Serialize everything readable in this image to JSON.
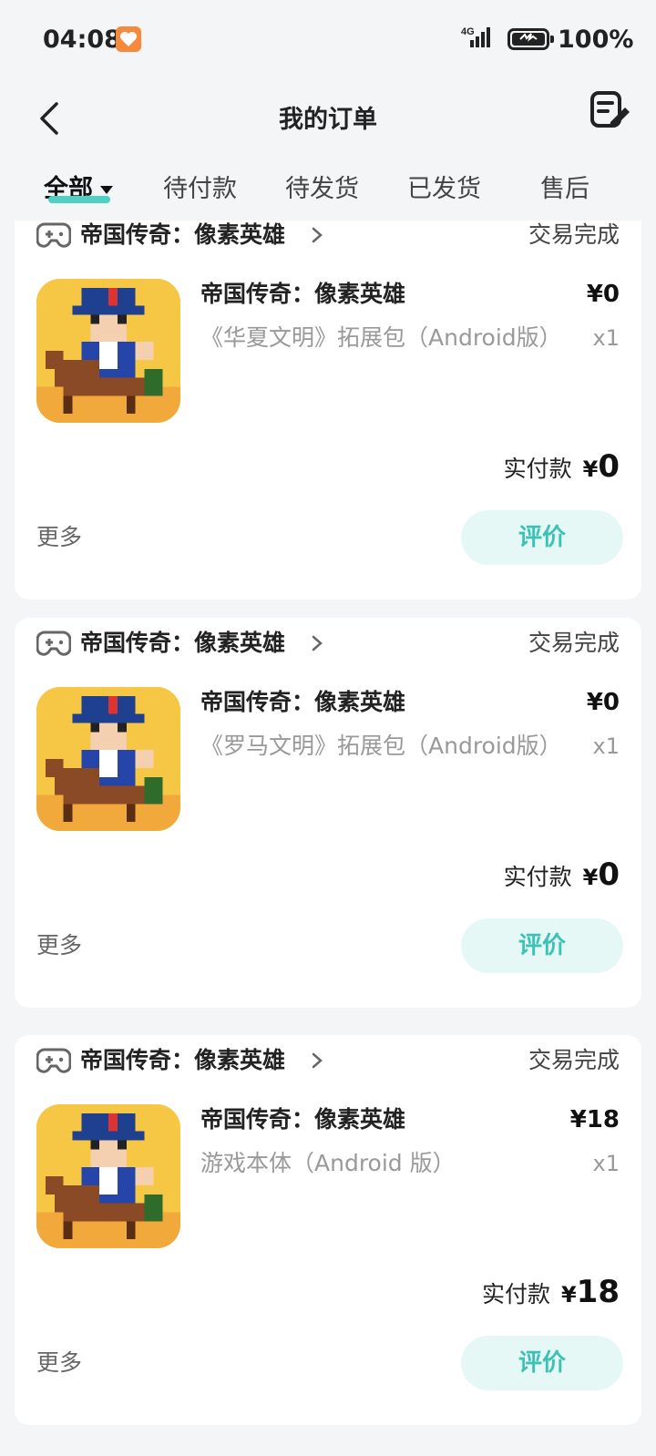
{
  "status_bar": {
    "time": "04:08",
    "network": "4G",
    "battery": "100%"
  },
  "header": {
    "title": "我的订单"
  },
  "tabs": [
    {
      "label": "全部",
      "active": true
    },
    {
      "label": "待付款",
      "active": false
    },
    {
      "label": "待发货",
      "active": false
    },
    {
      "label": "已发货",
      "active": false
    },
    {
      "label": "售后",
      "active": false
    }
  ],
  "orders": [
    {
      "store_name": "帝国传奇：像素英雄",
      "status": "交易完成",
      "product_title": "帝国传奇：像素英雄",
      "price": "¥0",
      "description": "《华夏文明》拓展包（Android版）",
      "quantity": "x1",
      "paid_label": "实付款",
      "paid_currency": "¥",
      "paid_amount": "0",
      "more_label": "更多",
      "review_label": "评价"
    },
    {
      "store_name": "帝国传奇：像素英雄",
      "status": "交易完成",
      "product_title": "帝国传奇：像素英雄",
      "price": "¥0",
      "description": "《罗马文明》拓展包（Android版）",
      "quantity": "x1",
      "paid_label": "实付款",
      "paid_currency": "¥",
      "paid_amount": "0",
      "more_label": "更多",
      "review_label": "评价"
    },
    {
      "store_name": "帝国传奇：像素英雄",
      "status": "交易完成",
      "product_title": "帝国传奇：像素英雄",
      "price": "¥18",
      "description": "游戏本体（Android 版）",
      "quantity": "x1",
      "paid_label": "实付款",
      "paid_currency": "¥",
      "paid_amount": "18",
      "more_label": "更多",
      "review_label": "评价"
    }
  ],
  "colors": {
    "accent": "#4fd0c4",
    "review_bg": "#e6f8f6",
    "review_text": "#3cc2b5",
    "page_bg": "#f4f5f7"
  }
}
